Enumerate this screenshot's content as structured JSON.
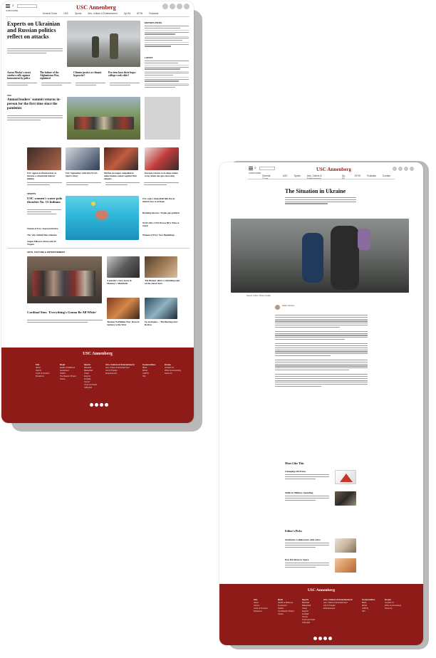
{
  "brand": "USC Annenberg",
  "nav": [
    "General Cover",
    "USC",
    "Sports",
    "Arts, Culture & Entertainment",
    "Op-Ed",
    "ATVN",
    "Podcasts",
    "Contact"
  ],
  "home": {
    "hero_headline": "Experts on Ukrainian and Russian politics reflect on attacks",
    "editors_picks_label": "EDITOR'S PICKS",
    "latest_label": "LATEST",
    "row1": [
      {
        "headline": "Aaron Meyka's street vendors rally against harassment by police"
      },
      {
        "headline": "The failure of the Afghanistan War, explained"
      },
      {
        "headline": "Climate justice or climate hypocrite?"
      },
      {
        "headline": "Pro-teen loses their hope: college work ethic?"
      }
    ],
    "usc_label": "USC",
    "usc_headline": "Annual leaders' summit returns in-person for the first time since the pandemic",
    "row2": [
      {
        "headline": "USC approves Election Day to become a schoolwide federal holiday"
      },
      {
        "headline": "USC September with Wei NCAA Sports Glory"
      },
      {
        "headline": "Marian no longer compelled to make human contact against firm dangers"
      },
      {
        "headline": "Increase returns to its ideas makes to lay about one quo-tasse ship"
      }
    ],
    "sports_label": "SPORTS",
    "sports_headline": "USC women's water polo thrashes No. 15 Indiana",
    "sports_side": [
      {
        "headline": "USC men's basketball falls flat in interest loss to Arizona"
      },
      {
        "headline": "Breaking the law: Trojan ago political"
      },
      {
        "headline": "NASCAR's CEO Proves 80% Wins to reach"
      },
      {
        "headline": "Women of Troy: New Beginnings"
      }
    ],
    "sports_list": [
      {
        "headline": "Women of Troy: Season in Review"
      },
      {
        "headline": "The 'why' behind Mace Alamein"
      },
      {
        "headline": "Jaquez Ellison is driven with 40 Trojans"
      }
    ],
    "ace_label": "ARTS, CULTURE & ENTERTAINMENT",
    "ace_headline": "Cardinal Sins: 'Everything's Gonna Be All White'",
    "ace_side": [
      {
        "headline": "A murder's story focus in Mommy's 'Multitude'"
      },
      {
        "headline": "'Pet Bunnet' offers a refreshing take on the classic hero"
      },
      {
        "headline": "'Reckon To Hidden Way' Drawer: Journey to the West"
      },
      {
        "headline": "Up in Flames... 'The Burning Sun' Review"
      }
    ]
  },
  "article": {
    "title": "The Situation in Ukraine",
    "caption": "Source: Flickr / Photo Credits",
    "author": "Sarah Johnson",
    "more_label": "More Like This",
    "more": [
      {
        "headline": "Changing Oil Prices"
      },
      {
        "headline": "Shifts in Military Spending"
      }
    ],
    "editors_label": "Editor's Picks",
    "editors": [
      {
        "headline": "Starbucks Collaborates with Selva"
      },
      {
        "headline": "Pets Davidson to Space"
      }
    ]
  },
  "footer": {
    "title": "USC Annenberg",
    "columns": [
      {
        "head": "Info",
        "items": [
          "About",
          "Alumni",
          "Code of Conduct",
          "Donations"
        ]
      },
      {
        "head": "Read",
        "items": [
          "Health & Wellness",
          "Investment",
          "Politics",
          "The Beacon Project",
          "Voices"
        ]
      },
      {
        "head": "Sports",
        "items": [
          "Baseball",
          "Basketball",
          "Cheer",
          "Esports",
          "Football",
          "Soccer",
          "Track and Field",
          "Volleyball"
        ]
      },
      {
        "head": "Arts, Culture & Entertainment",
        "items": [
          "Arts, Culture & Entertainment",
          "Arts & Theater",
          "Entertainment"
        ]
      },
      {
        "head": "Communities",
        "items": [
          "Black",
          "Ethnic",
          "LGBTQ",
          "ISN"
        ]
      },
      {
        "head": "Hoops",
        "items": [
          "Contact Us",
          "Write for Annenberg",
          "Stock Up"
        ]
      }
    ]
  },
  "colors": {
    "brand_red": "#8e1b17"
  }
}
